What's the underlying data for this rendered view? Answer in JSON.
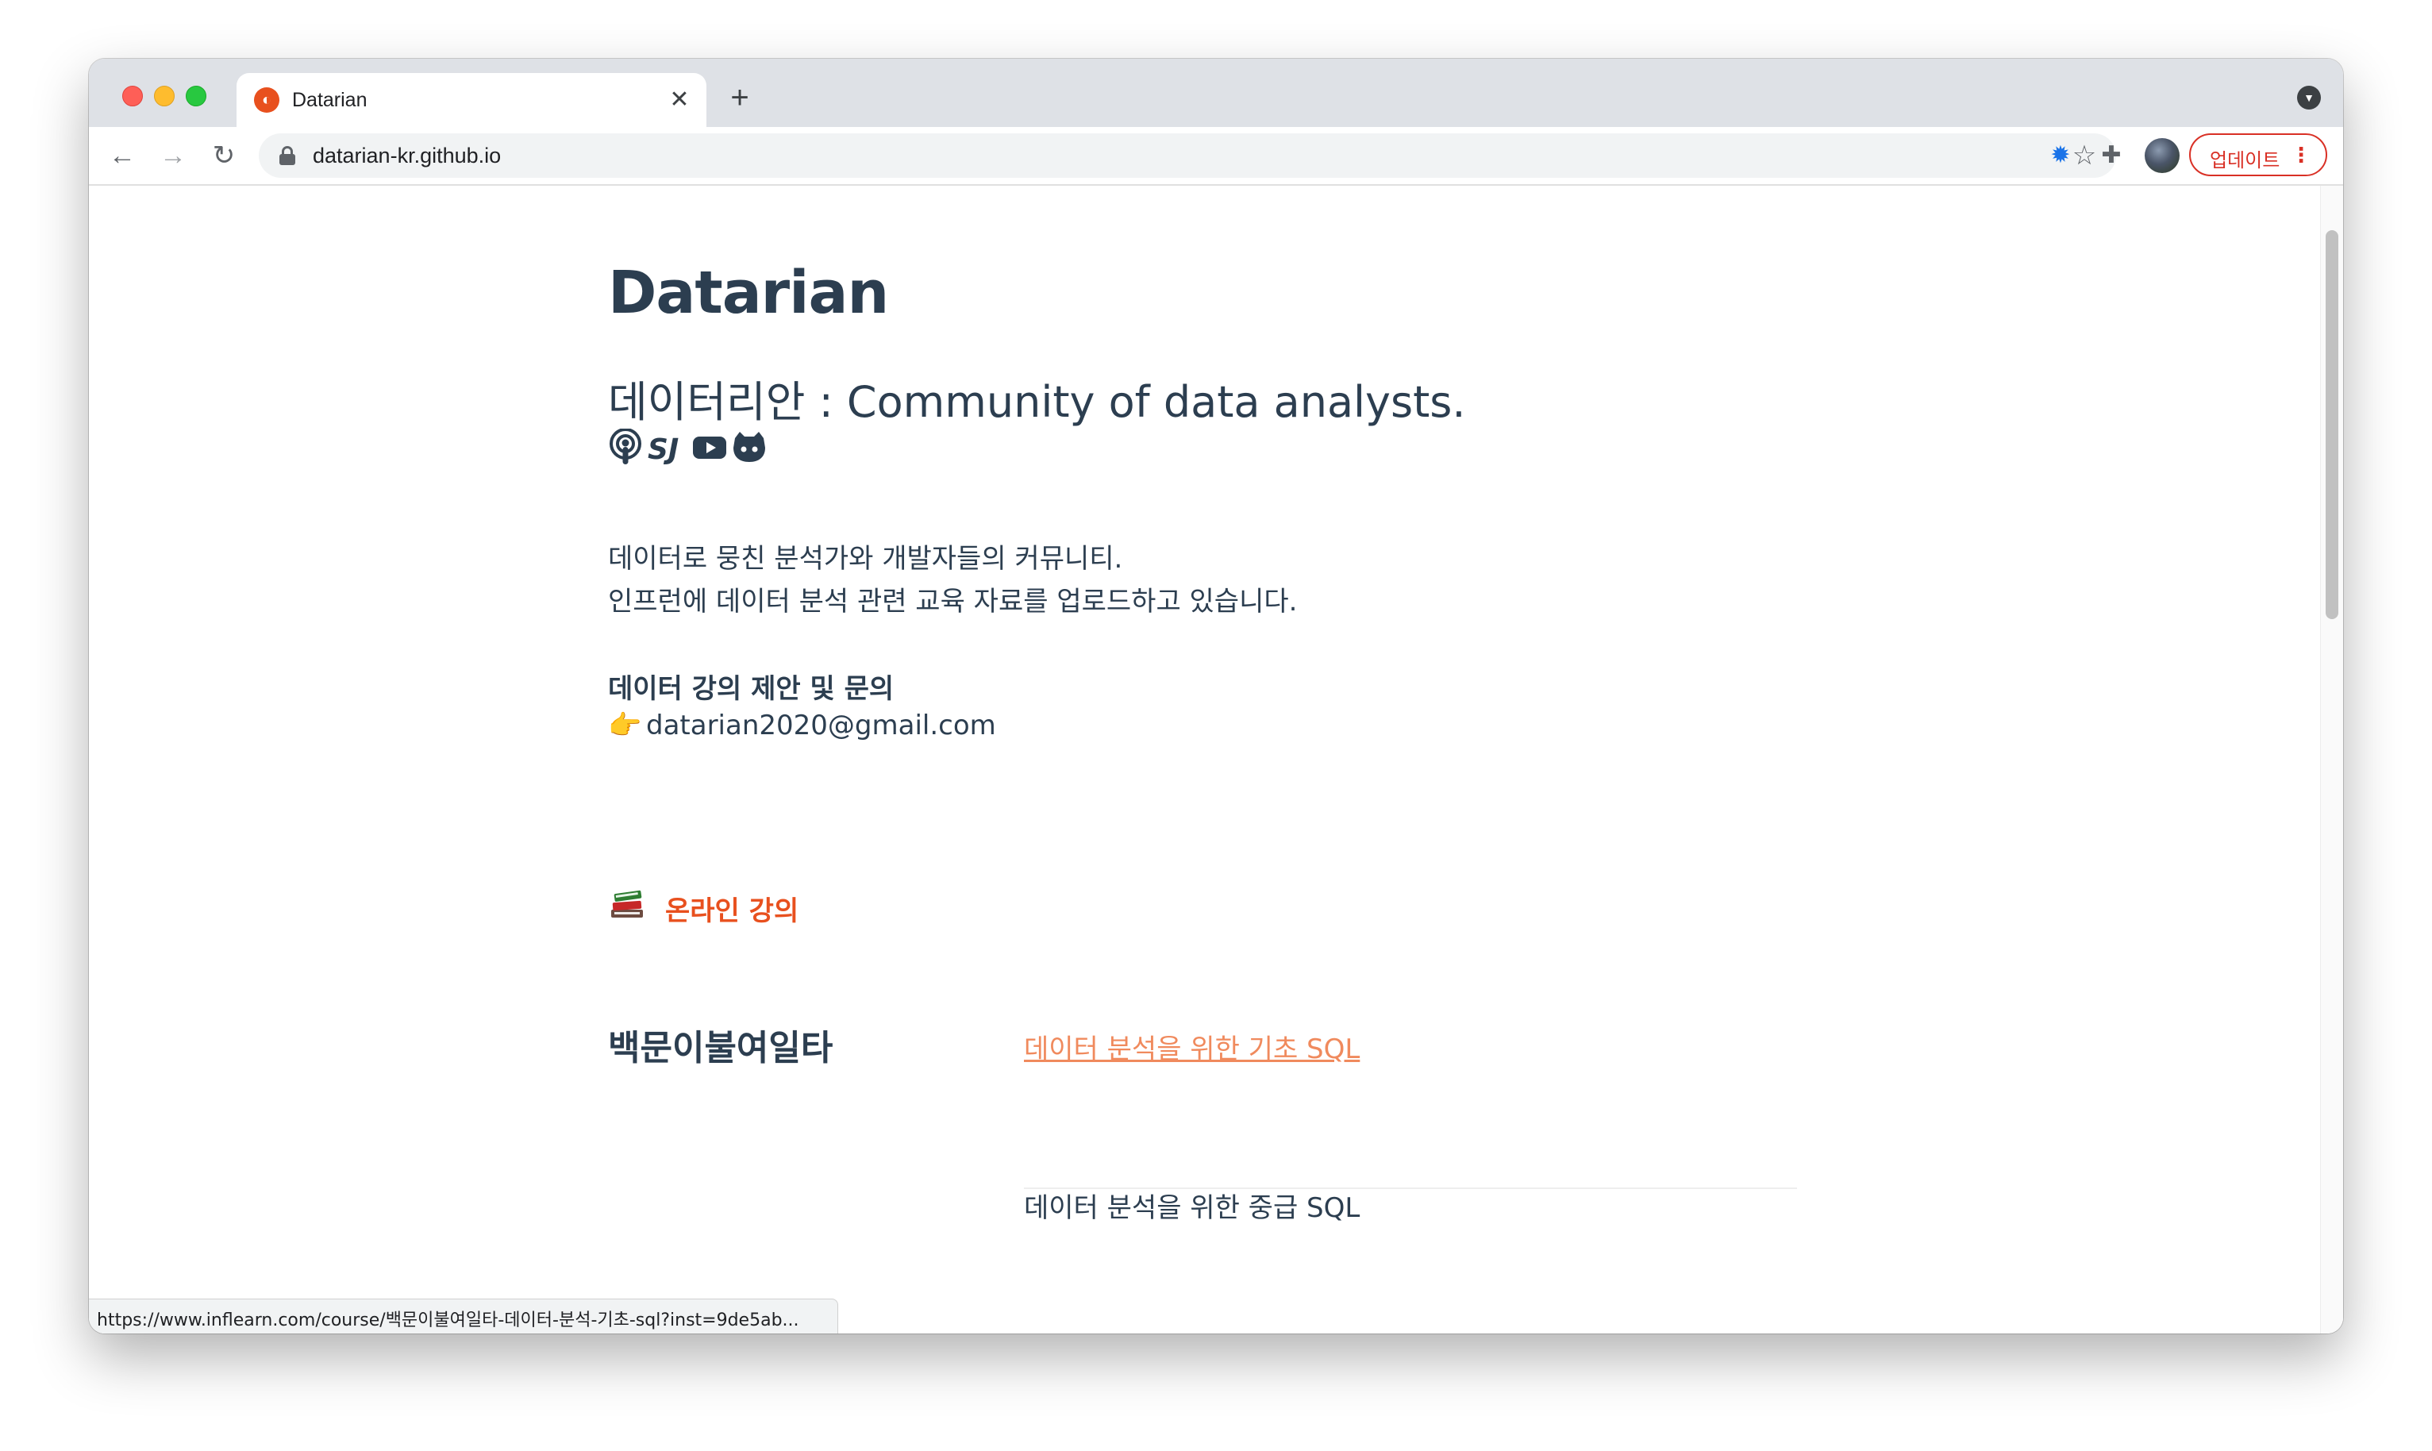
{
  "browser": {
    "tab": {
      "title": "Datarian",
      "close_glyph": "✕",
      "favicon": "datarian-favicon-icon"
    },
    "new_tab_glyph": "+",
    "nav": {
      "back_glyph": "←",
      "forward_glyph": "→",
      "reload_glyph": "↻"
    },
    "address_bar": {
      "url": "datarian-kr.github.io"
    },
    "bookmark_glyph": "☆",
    "extension_bug_glyph": "✹",
    "extensions_glyph": "✚",
    "update_button": {
      "label": "업데이트",
      "menu_glyph": "⋮"
    },
    "status_bar_url": "https://www.inflearn.com/course/백문이불여일타-데이터-분석-기초-sql?inst=9de5ab..."
  },
  "page": {
    "title": "Datarian",
    "subtitle": "데이터리안 : Community of data analysts.",
    "social_icons": [
      "podcast-icon",
      "sj-icon",
      "youtube-icon",
      "github-icon"
    ],
    "description": [
      "데이터로 뭉친 분석가와 개발자들의 커뮤니티.",
      "인프런에 데이터 분석 관련 교육 자료를 업로드하고 있습니다."
    ],
    "contact": {
      "heading": "데이터 강의 제안 및 문의",
      "emoji": "👉",
      "email": "datarian2020@gmail.com"
    },
    "online_courses": {
      "icon": "books-icon",
      "label": "온라인 강의"
    },
    "courses": {
      "group_title": "백문이불여일타",
      "items": [
        {
          "title": "데이터 분석을 위한 기초 SQL",
          "is_link": true
        },
        {
          "title": "데이터 분석을 위한 중급 SQL",
          "is_link": false
        }
      ]
    }
  },
  "colors": {
    "text": "#2c3e50",
    "accent": "#e8501e",
    "link": "#f08a5d",
    "update_red": "#d93025"
  }
}
